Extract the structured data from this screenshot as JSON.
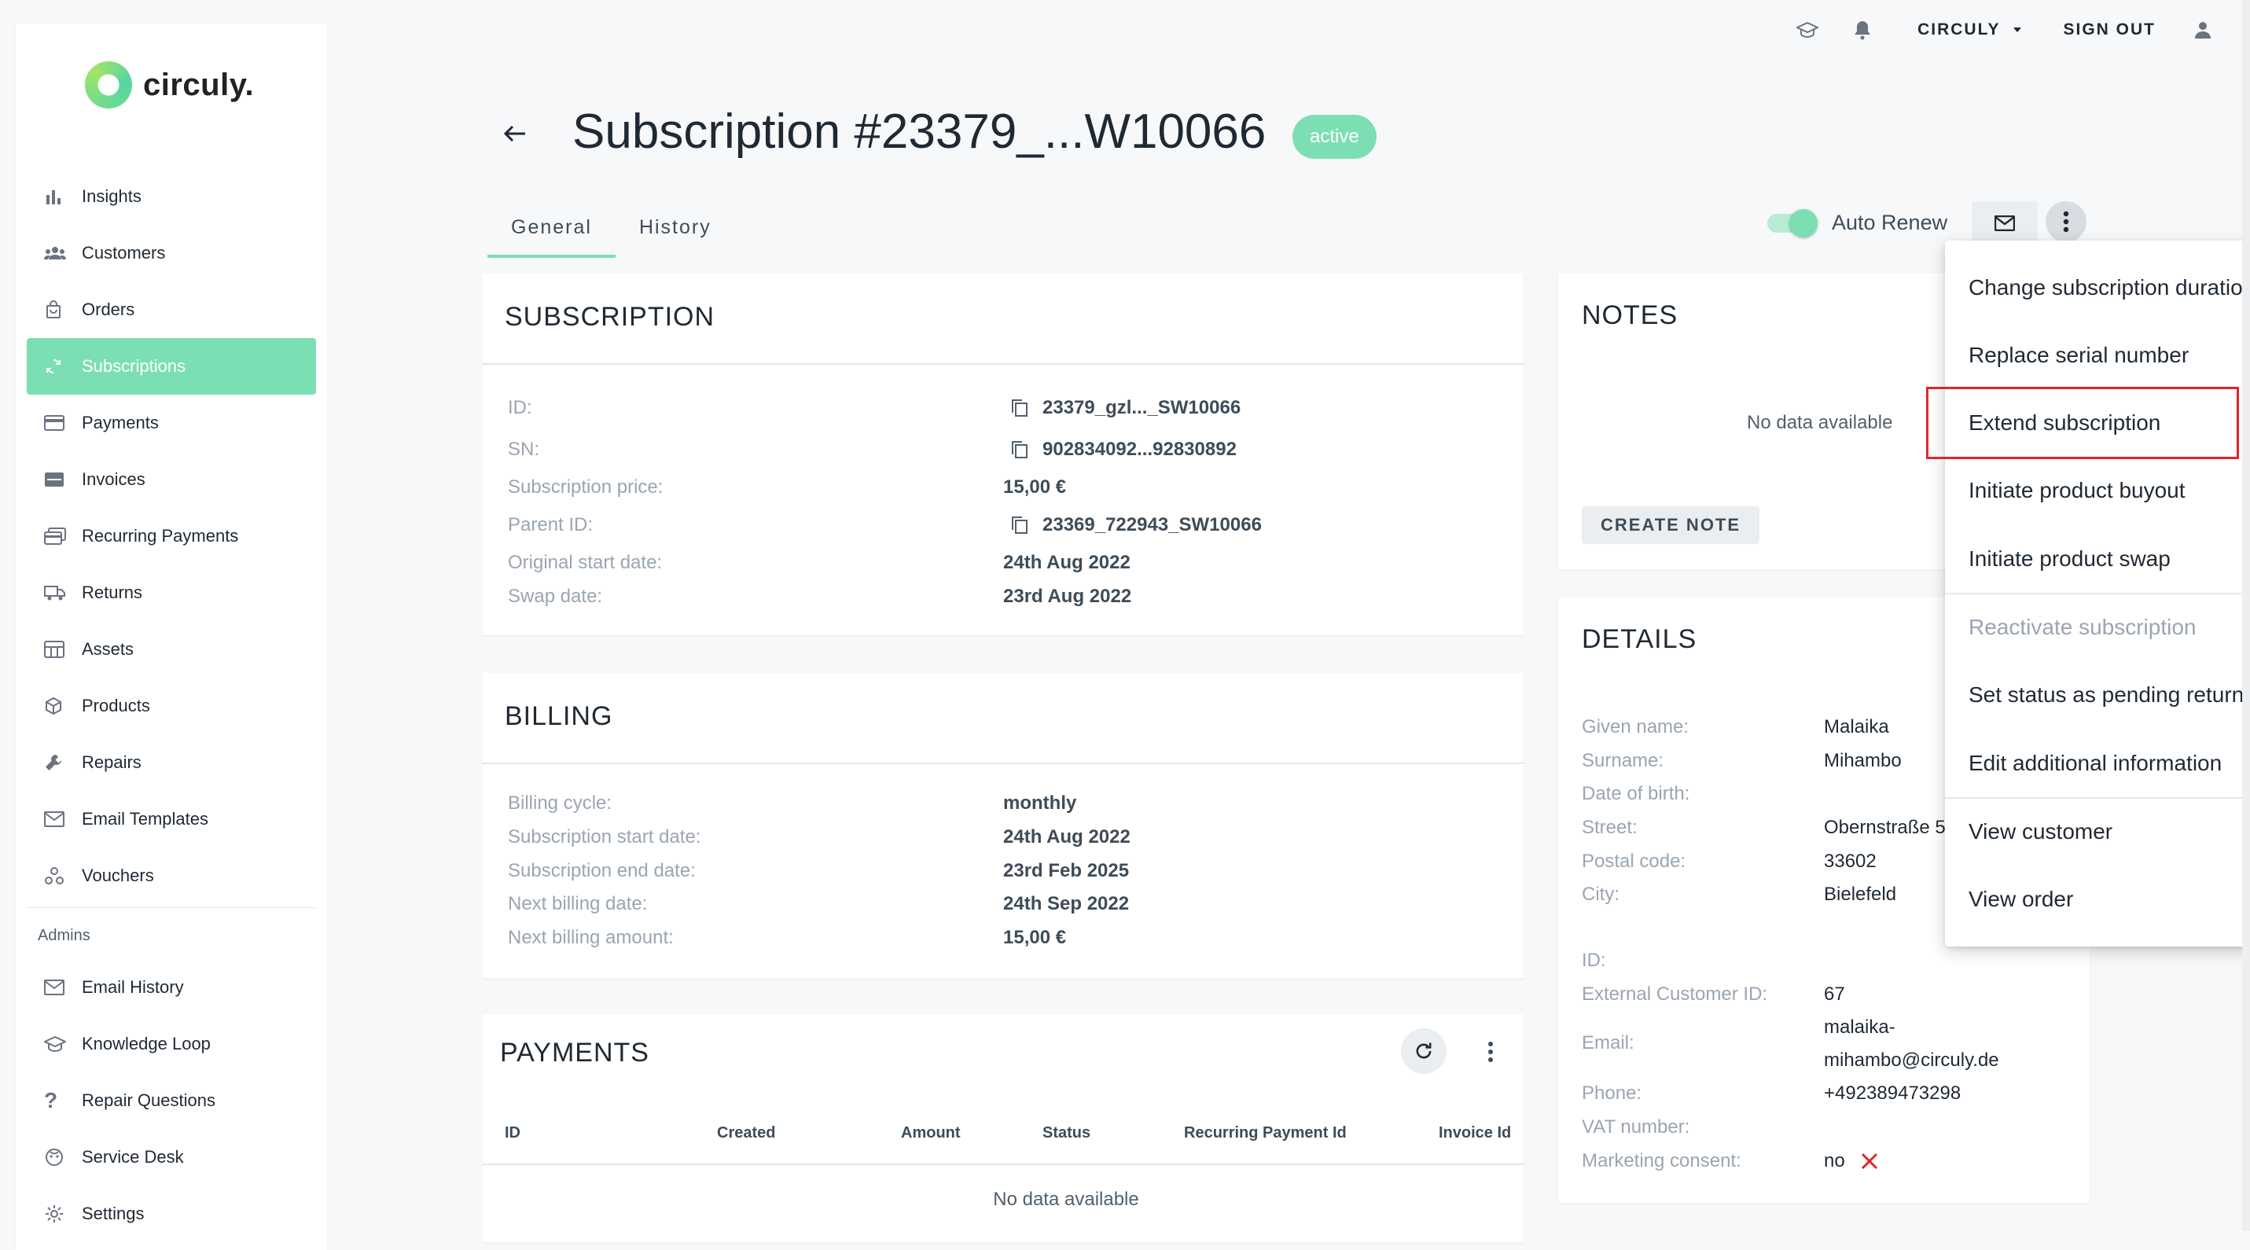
{
  "brand": {
    "name": "circuly."
  },
  "sidebar": {
    "items": [
      {
        "label": "Insights",
        "icon": "bar-chart-icon"
      },
      {
        "label": "Customers",
        "icon": "people-icon"
      },
      {
        "label": "Orders",
        "icon": "shopping-bag-icon"
      },
      {
        "label": "Subscriptions",
        "icon": "refresh-icon",
        "active": true
      },
      {
        "label": "Payments",
        "icon": "credit-card-icon"
      },
      {
        "label": "Invoices",
        "icon": "invoice-icon"
      },
      {
        "label": "Recurring Payments",
        "icon": "recurring-payments-icon"
      },
      {
        "label": "Returns",
        "icon": "truck-icon"
      },
      {
        "label": "Assets",
        "icon": "storage-icon"
      },
      {
        "label": "Products",
        "icon": "box-icon"
      },
      {
        "label": "Repairs",
        "icon": "wrench-icon"
      },
      {
        "label": "Email Templates",
        "icon": "envelope-icon"
      },
      {
        "label": "Vouchers",
        "icon": "vouchers-icon"
      }
    ],
    "admins_label": "Admins",
    "admin_items": [
      {
        "label": "Email History",
        "icon": "envelope-icon"
      },
      {
        "label": "Knowledge Loop",
        "icon": "graduation-cap-icon"
      },
      {
        "label": "Repair Questions",
        "icon": "question-icon"
      },
      {
        "label": "Service Desk",
        "icon": "support-icon"
      },
      {
        "label": "Settings",
        "icon": "gear-icon"
      }
    ]
  },
  "topbar": {
    "account": "CIRCULY",
    "signout": "SIGN OUT"
  },
  "header": {
    "title": "Subscription #23379_...W10066",
    "status": "active"
  },
  "tabs": [
    "General",
    "History"
  ],
  "actions": {
    "auto_renew_label": "Auto Renew",
    "auto_renew": true
  },
  "subscription": {
    "heading": "SUBSCRIPTION",
    "rows": [
      {
        "label": "ID:",
        "value": "23379_gzl..._SW10066",
        "copy": true
      },
      {
        "label": "SN:",
        "value": "902834092...92830892",
        "copy": true
      },
      {
        "label": "Subscription price:",
        "value": "15,00 €"
      },
      {
        "label": "Parent ID:",
        "value": "23369_722943_SW10066",
        "copy": true
      },
      {
        "label": "Original start date:",
        "value": "24th Aug 2022"
      },
      {
        "label": "Swap date:",
        "value": "23rd Aug 2022"
      }
    ]
  },
  "billing": {
    "heading": "BILLING",
    "rows": [
      {
        "label": "Billing cycle:",
        "value": "monthly"
      },
      {
        "label": "Subscription start date:",
        "value": "24th Aug 2022"
      },
      {
        "label": "Subscription end date:",
        "value": "23rd Feb 2025"
      },
      {
        "label": "Next billing date:",
        "value": "24th Sep 2022"
      },
      {
        "label": "Next billing amount:",
        "value": "15,00 €"
      }
    ]
  },
  "payments": {
    "heading": "PAYMENTS",
    "columns": [
      "ID",
      "Created",
      "Amount",
      "Status",
      "Recurring Payment Id",
      "Invoice Id"
    ],
    "empty": "No data available"
  },
  "notes": {
    "heading": "NOTES",
    "empty": "No data available",
    "create_label": "CREATE NOTE"
  },
  "details": {
    "heading": "DETAILS",
    "rows": [
      {
        "label": "Given name:",
        "value": "Malaika"
      },
      {
        "label": "Surname:",
        "value": "Mihambo"
      },
      {
        "label": "Date of birth:",
        "value": ""
      },
      {
        "label": "Street:",
        "value": "Obernstraße 5"
      },
      {
        "label": "Postal code:",
        "value": "33602"
      },
      {
        "label": "City:",
        "value": "Bielefeld"
      },
      {
        "label": "ID:",
        "value": ""
      },
      {
        "label": "External Customer ID:",
        "value": "67"
      },
      {
        "label": "Email:",
        "value": "malaika-\nmihambo@circuly.de"
      },
      {
        "label": "Phone:",
        "value": "+492389473298"
      },
      {
        "label": "VAT number:",
        "value": ""
      },
      {
        "label": "Marketing consent:",
        "value": "no"
      }
    ]
  },
  "menu": {
    "items": [
      {
        "label": "Change subscription duration"
      },
      {
        "label": "Replace serial number"
      },
      {
        "label": "Extend subscription",
        "highlighted": true
      },
      {
        "label": "Initiate product buyout"
      },
      {
        "label": "Initiate product swap"
      },
      {
        "label": "Reactivate subscription",
        "disabled": true
      },
      {
        "label": "Set status as pending return"
      },
      {
        "label": "Edit additional information"
      },
      {
        "label": "View customer"
      },
      {
        "label": "View order"
      }
    ]
  },
  "colors": {
    "accent": "#7cdfb4",
    "highlight": "#e0262a",
    "no_mark": "#e0262a"
  }
}
